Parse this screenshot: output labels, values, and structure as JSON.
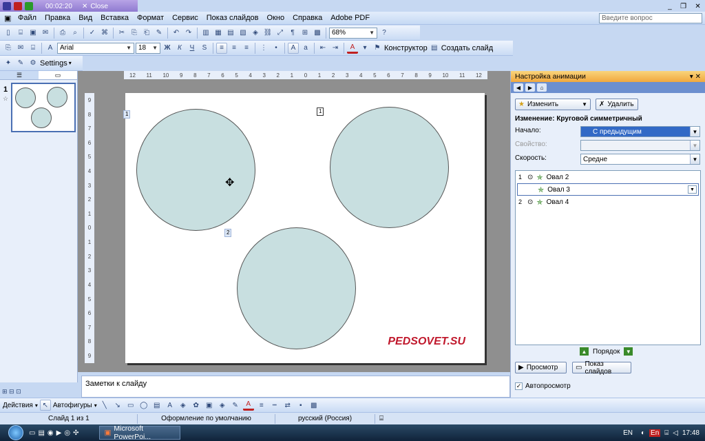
{
  "recorder": {
    "timer": "00:02:20",
    "close": "Close"
  },
  "menu": [
    "Файл",
    "Правка",
    "Вид",
    "Вставка",
    "Формат",
    "Сервис",
    "Показ слайдов",
    "Окно",
    "Справка",
    "Adobe PDF"
  ],
  "help_placeholder": "Введите вопрос",
  "toolbar": {
    "zoom": "68%",
    "font": "Arial",
    "size": "18",
    "bold": "Ж",
    "italic": "К",
    "underline": "Ч",
    "shadow": "S",
    "designer": "Конструктор",
    "new_slide": "Создать слайд",
    "settings": "Settings"
  },
  "left_pane": {
    "slide_number": "1"
  },
  "slide": {
    "tag1": "1",
    "tag2": "2",
    "tag3": "1",
    "watermark": "PEDSOVET.SU"
  },
  "ruler": {
    "h": [
      "12",
      "11",
      "10",
      "9",
      "8",
      "7",
      "6",
      "5",
      "4",
      "3",
      "2",
      "1",
      "0",
      "1",
      "2",
      "3",
      "4",
      "5",
      "6",
      "7",
      "8",
      "9",
      "10",
      "11",
      "12"
    ],
    "v": [
      "9",
      "8",
      "7",
      "6",
      "5",
      "4",
      "3",
      "2",
      "1",
      "0",
      "1",
      "2",
      "3",
      "4",
      "5",
      "6",
      "7",
      "8",
      "9"
    ]
  },
  "notes_placeholder": "Заметки к слайду",
  "task_pane": {
    "title": "Настройка анимации",
    "change_btn": "Изменить",
    "delete_btn": "Удалить",
    "effect_label": "Изменение: Круговой симметричный",
    "start_label": "Начало:",
    "start_value": "С предыдущим",
    "property_label": "Свойство:",
    "speed_label": "Скорость:",
    "speed_value": "Средне",
    "items": [
      {
        "num": "1",
        "name": "Овал 2"
      },
      {
        "num": "",
        "name": "Овал 3"
      },
      {
        "num": "2",
        "name": "Овал 4"
      }
    ],
    "order_label": "Порядок",
    "preview_btn": "Просмотр",
    "slideshow_btn": "Показ слайдов",
    "autopreview": "Автопросмотр"
  },
  "drawbar": {
    "actions": "Действия",
    "autoshapes": "Автофигуры"
  },
  "status": {
    "slide": "Слайд 1 из 1",
    "design": "Оформление по умолчанию",
    "lang": "русский (Россия)"
  },
  "taskbar": {
    "app": "Microsoft PowerPoi...",
    "lang": "EN",
    "lang2": "En",
    "time": "17:48"
  }
}
